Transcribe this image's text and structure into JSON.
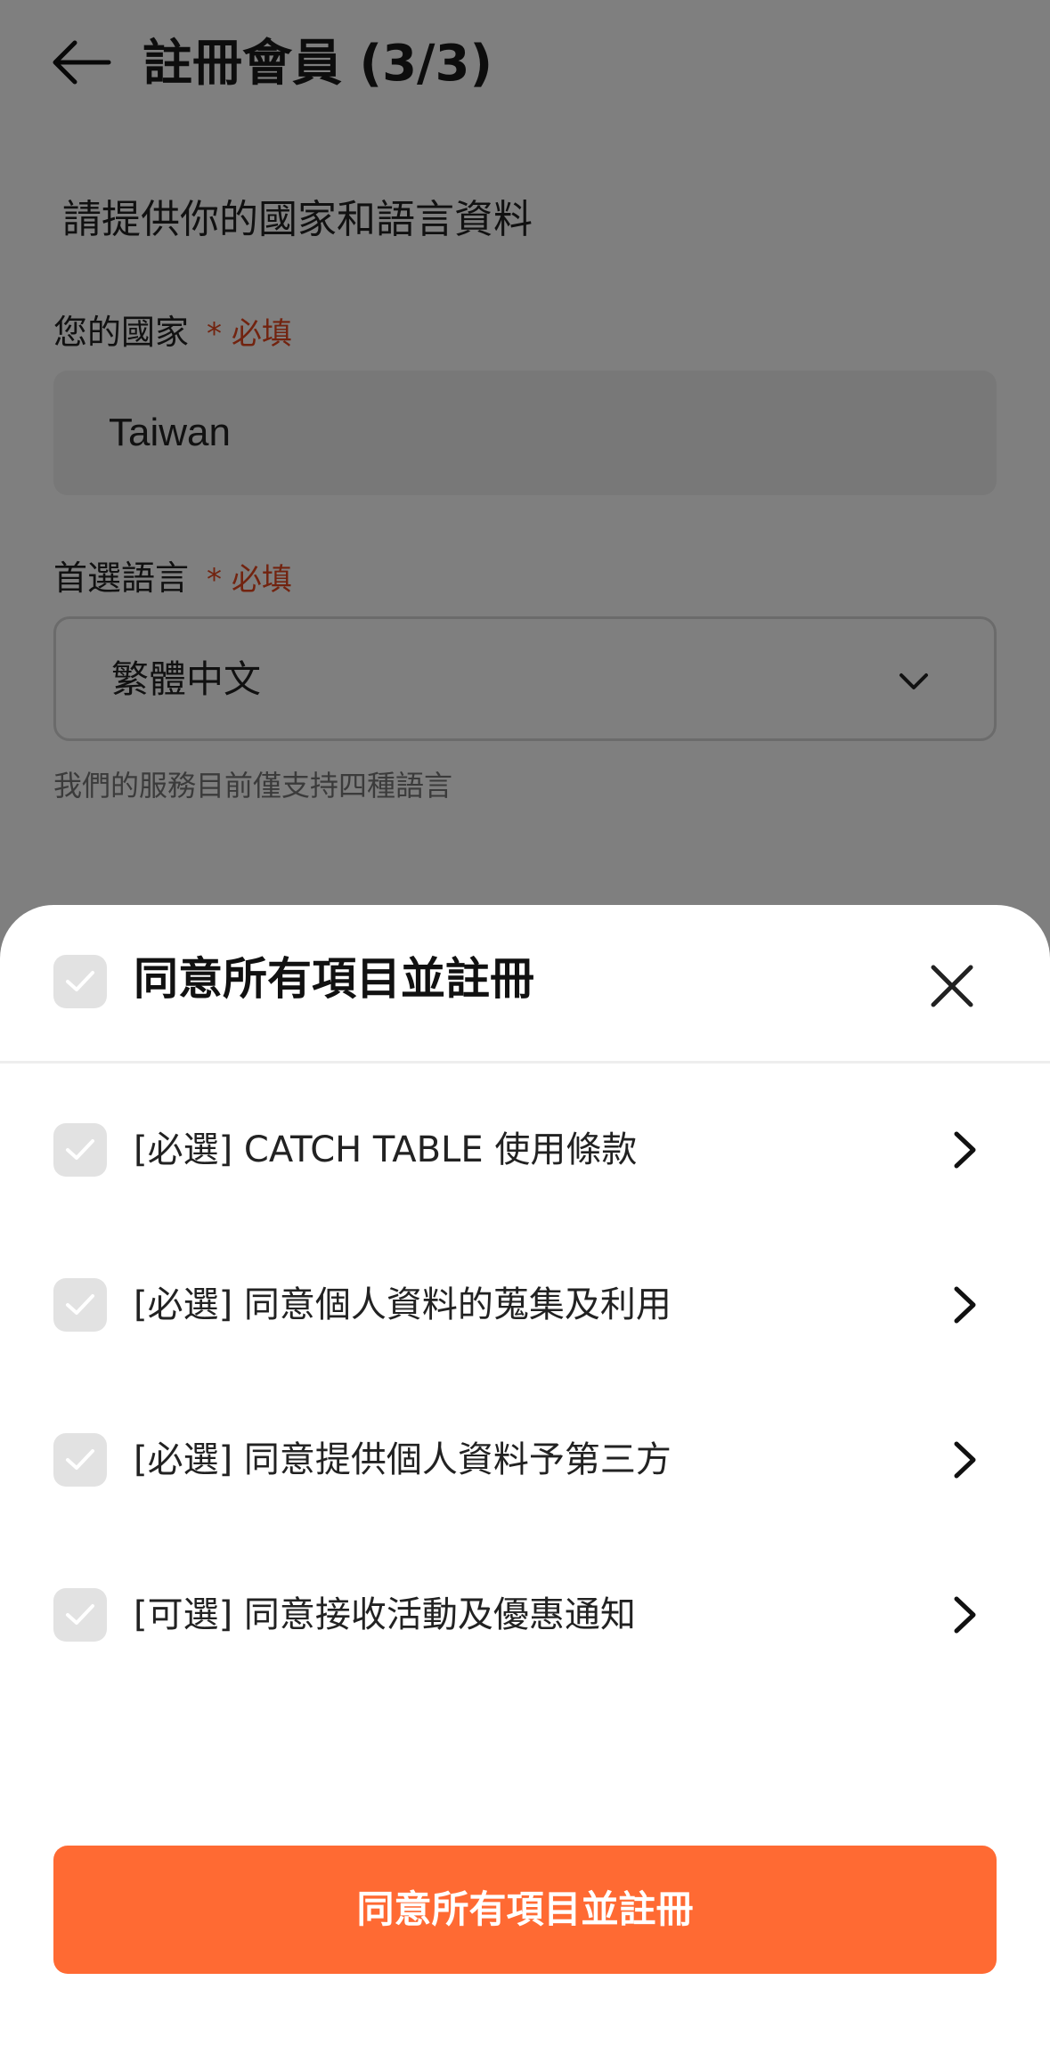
{
  "header": {
    "title": "註冊會員 (3/3)"
  },
  "form": {
    "subtitle": "請提供你的國家和語言資料",
    "country": {
      "label": "您的國家",
      "required": "* 必填",
      "value": "Taiwan"
    },
    "language": {
      "label": "首選語言",
      "required": "* 必填",
      "value": "繁體中文",
      "hint": "我們的服務目前僅支持四種語言"
    }
  },
  "sheet": {
    "title": "同意所有項目並註冊",
    "items": [
      {
        "label": "[必選] CATCH TABLE 使用條款"
      },
      {
        "label": "[必選] 同意個人資料的蒐集及利用"
      },
      {
        "label": "[必選] 同意提供個人資料予第三方"
      },
      {
        "label": "[可選] 同意接收活動及優惠通知"
      }
    ],
    "confirm_label": "同意所有項目並註冊"
  },
  "colors": {
    "accent": "#ff6a33",
    "required": "#e4471f",
    "checkbox": "#e2e2e2"
  }
}
